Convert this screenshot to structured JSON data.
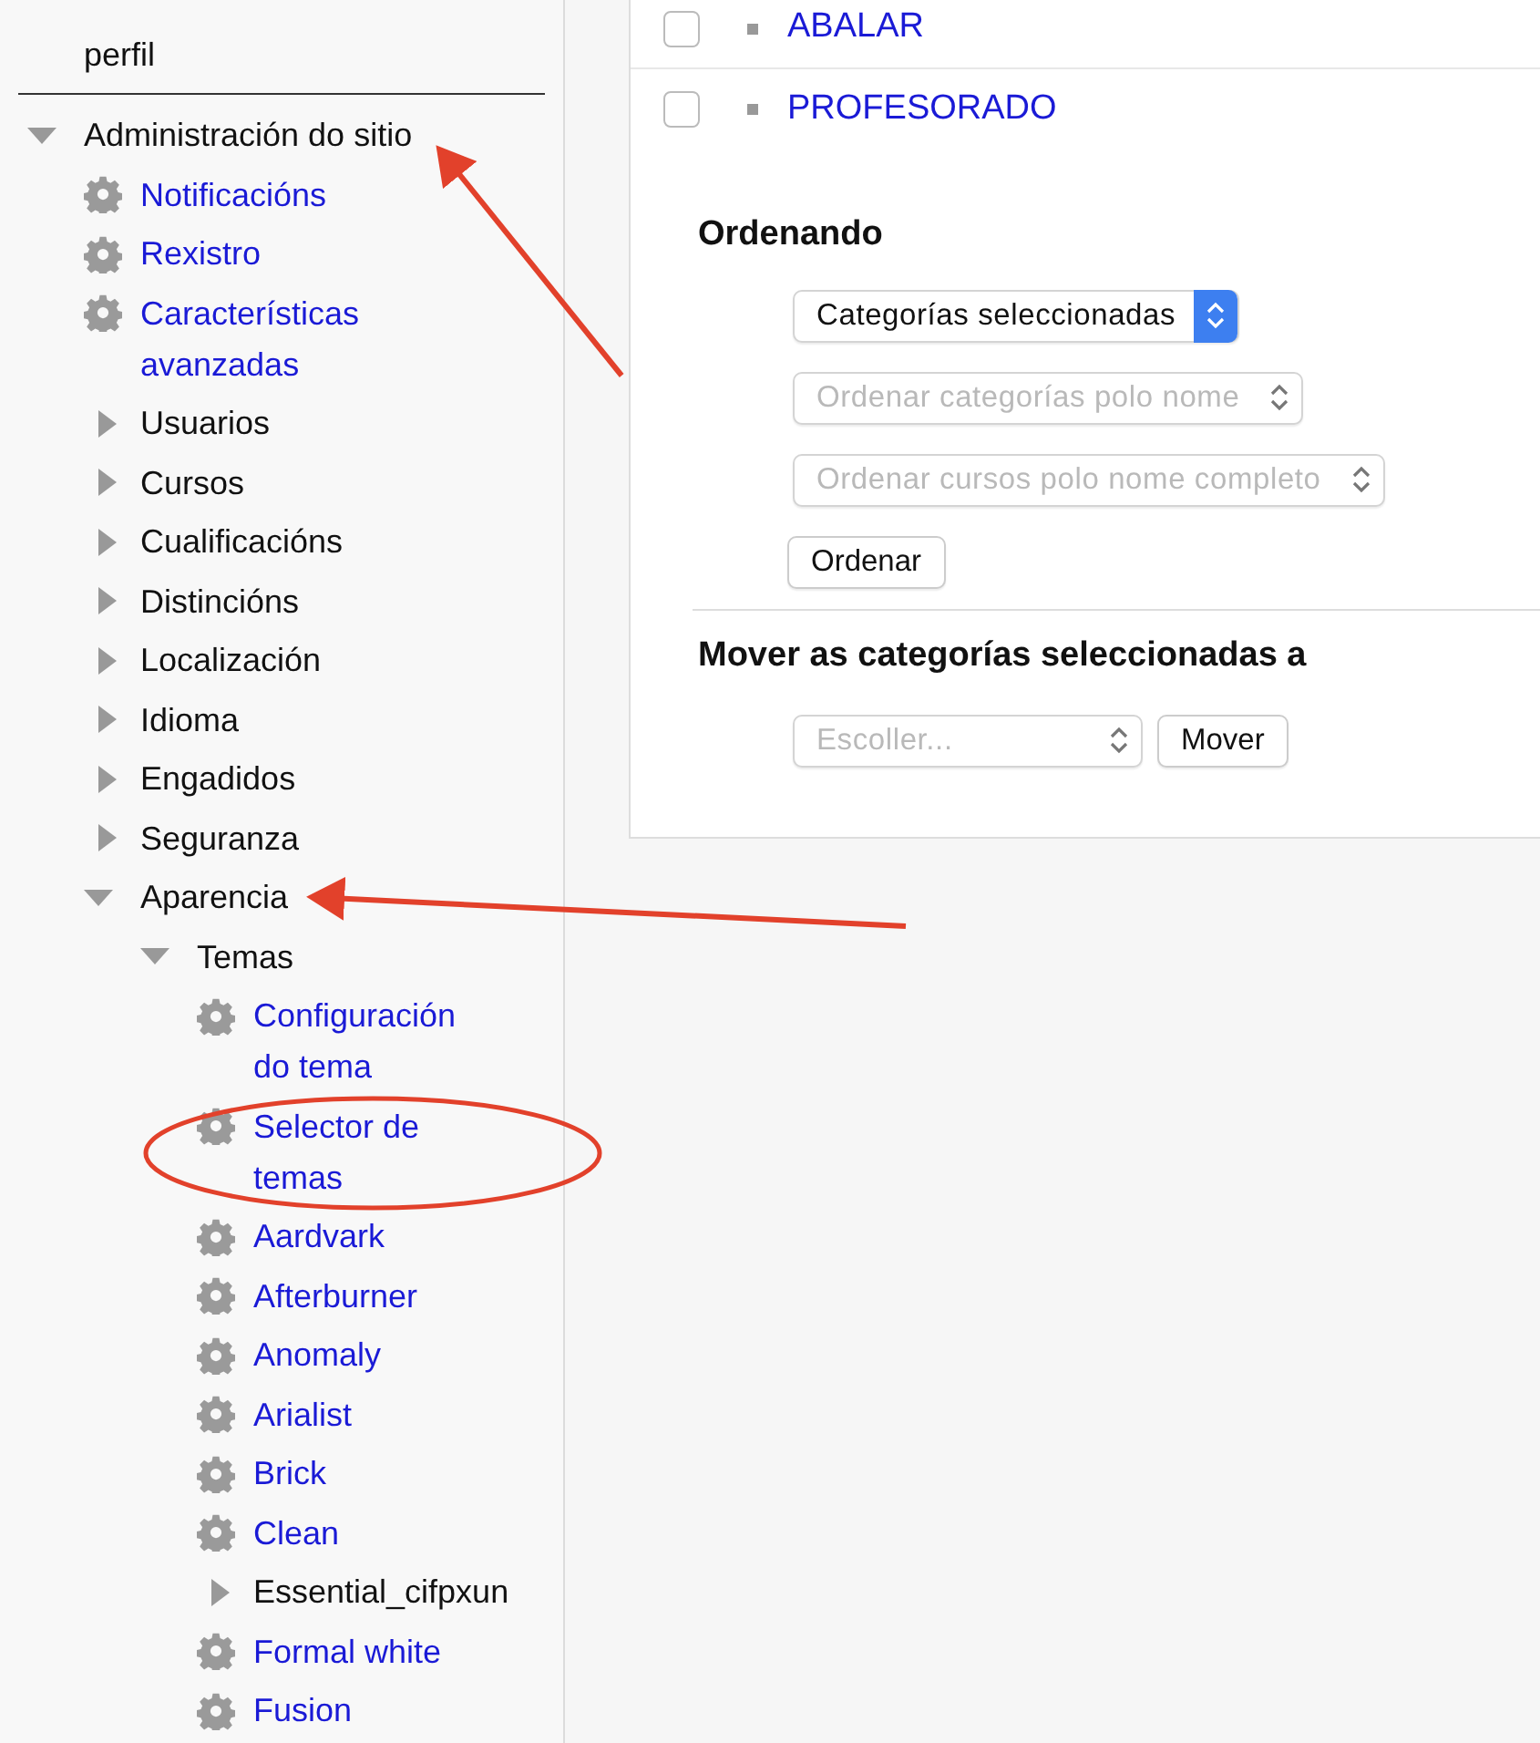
{
  "sidebar": {
    "partial_item": "perfil",
    "tree": [
      {
        "label": "Administración do sitio",
        "kind": "branch",
        "expanded": true,
        "arrow_pointing": true,
        "children": [
          {
            "label": "Notificacións",
            "kind": "link"
          },
          {
            "label": "Rexistro",
            "kind": "link"
          },
          {
            "label": "Características avanzadas",
            "kind": "link"
          },
          {
            "label": "Usuarios",
            "kind": "branch",
            "expanded": false
          },
          {
            "label": "Cursos",
            "kind": "branch",
            "expanded": false
          },
          {
            "label": "Cualificacións",
            "kind": "branch",
            "expanded": false
          },
          {
            "label": "Distincións",
            "kind": "branch",
            "expanded": false
          },
          {
            "label": "Localización",
            "kind": "branch",
            "expanded": false
          },
          {
            "label": "Idioma",
            "kind": "branch",
            "expanded": false
          },
          {
            "label": "Engadidos",
            "kind": "branch",
            "expanded": false
          },
          {
            "label": "Seguranza",
            "kind": "branch",
            "expanded": false
          },
          {
            "label": "Aparencia",
            "kind": "branch",
            "expanded": true,
            "arrow_pointing": true,
            "children": [
              {
                "label": "Temas",
                "kind": "branch",
                "expanded": true,
                "children": [
                  {
                    "label": "Configuración do tema",
                    "kind": "link"
                  },
                  {
                    "label": "Selector de temas",
                    "kind": "link",
                    "circled": true
                  },
                  {
                    "label": "Aardvark",
                    "kind": "link"
                  },
                  {
                    "label": "Afterburner",
                    "kind": "link"
                  },
                  {
                    "label": "Anomaly",
                    "kind": "link"
                  },
                  {
                    "label": "Arialist",
                    "kind": "link"
                  },
                  {
                    "label": "Brick",
                    "kind": "link"
                  },
                  {
                    "label": "Clean",
                    "kind": "link"
                  },
                  {
                    "label": "Essential_cifpxun",
                    "kind": "branch",
                    "expanded": false
                  },
                  {
                    "label": "Formal white",
                    "kind": "link"
                  },
                  {
                    "label": "Fusion",
                    "kind": "link"
                  }
                ]
              }
            ]
          }
        ]
      }
    ]
  },
  "categories": [
    {
      "name": "ABALAR",
      "checked": false
    },
    {
      "name": "PROFESORADO",
      "checked": false
    }
  ],
  "sorting": {
    "heading": "Ordenando",
    "selects": [
      {
        "value": "Categorías seleccionadas",
        "disabled": false
      },
      {
        "value": "Ordenar categorías polo nome",
        "disabled": true
      },
      {
        "value": "Ordenar cursos polo nome completo",
        "disabled": true
      }
    ],
    "button": "Ordenar"
  },
  "move": {
    "heading": "Mover as categorías seleccionadas a",
    "select": {
      "value": "Escoller...",
      "disabled": true
    },
    "button": "Mover"
  }
}
